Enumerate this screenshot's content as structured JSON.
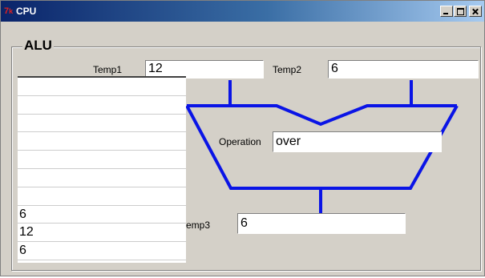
{
  "window": {
    "title": "CPU",
    "logo": "tk",
    "controls": [
      "minimize",
      "maximize",
      "close"
    ]
  },
  "alu": {
    "group_label": "ALU",
    "temp1": {
      "label": "Temp1",
      "value": "12"
    },
    "temp2": {
      "label": "Temp2",
      "value": "6"
    },
    "operation": {
      "label": "Operation",
      "value": "over"
    },
    "temp3": {
      "label": "emp3",
      "value": "6"
    },
    "stack": [
      "",
      "",
      "",
      "",
      "",
      "",
      "",
      "6",
      "12",
      "6"
    ],
    "colors": {
      "alu_lines": "#0a14e6",
      "titlebar": "#0a246a"
    }
  }
}
